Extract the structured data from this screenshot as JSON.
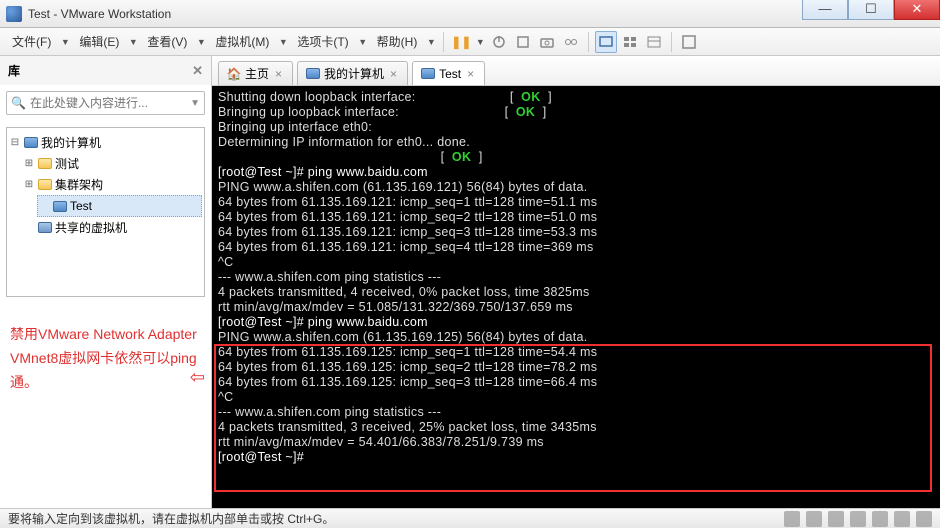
{
  "window": {
    "title": "Test - VMware Workstation"
  },
  "menu": {
    "file": "文件(F)",
    "edit": "编辑(E)",
    "view": "查看(V)",
    "vm": "虚拟机(M)",
    "tabs": "选项卡(T)",
    "help": "帮助(H)"
  },
  "sidebar": {
    "title": "库",
    "search_placeholder": "在此处键入内容进行...",
    "tree": {
      "root": "我的计算机",
      "n1": "测试",
      "n2": "集群架构",
      "n3": "Test",
      "shared": "共享的虚拟机"
    },
    "annotation": "禁用VMware Network Adapter VMnet8虚拟网卡依然可以ping通。"
  },
  "tabs": {
    "home": "主页",
    "mycomp": "我的计算机",
    "test": "Test"
  },
  "terminal": {
    "l01a": "Shutting down loopback interface:                         [  ",
    "l01b": "  ]",
    "l02a": "Bringing up loopback interface:                            [  ",
    "l02b": "  ]",
    "l03": "Bringing up interface eth0:",
    "l04": "Determining IP information for eth0... done.",
    "l05a": "                                                           [  ",
    "l05b": "  ]",
    "l06": "[root@Test ~]# ping www.baidu.com",
    "l07": "PING www.a.shifen.com (61.135.169.121) 56(84) bytes of data.",
    "l08": "64 bytes from 61.135.169.121: icmp_seq=1 ttl=128 time=51.1 ms",
    "l09": "64 bytes from 61.135.169.121: icmp_seq=2 ttl=128 time=51.0 ms",
    "l10": "64 bytes from 61.135.169.121: icmp_seq=3 ttl=128 time=53.3 ms",
    "l11": "64 bytes from 61.135.169.121: icmp_seq=4 ttl=128 time=369 ms",
    "l12": "^C",
    "l13": "--- www.a.shifen.com ping statistics ---",
    "l14": "4 packets transmitted, 4 received, 0% packet loss, time 3825ms",
    "l15": "rtt min/avg/max/mdev = 51.085/131.322/369.750/137.659 ms",
    "l16": "[root@Test ~]# ping www.baidu.com",
    "l17": "PING www.a.shifen.com (61.135.169.125) 56(84) bytes of data.",
    "l18": "64 bytes from 61.135.169.125: icmp_seq=1 ttl=128 time=54.4 ms",
    "l19": "64 bytes from 61.135.169.125: icmp_seq=2 ttl=128 time=78.2 ms",
    "l20": "64 bytes from 61.135.169.125: icmp_seq=3 ttl=128 time=66.4 ms",
    "l21": "^C",
    "l22": "--- www.a.shifen.com ping statistics ---",
    "l23": "4 packets transmitted, 3 received, 25% packet loss, time 3435ms",
    "l24": "rtt min/avg/max/mdev = 54.401/66.383/78.251/9.739 ms",
    "l25": "[root@Test ~]# ",
    "ok": "OK"
  },
  "status": {
    "text": "要将输入定向到该虚拟机，请在虚拟机内部单击或按 Ctrl+G。"
  }
}
